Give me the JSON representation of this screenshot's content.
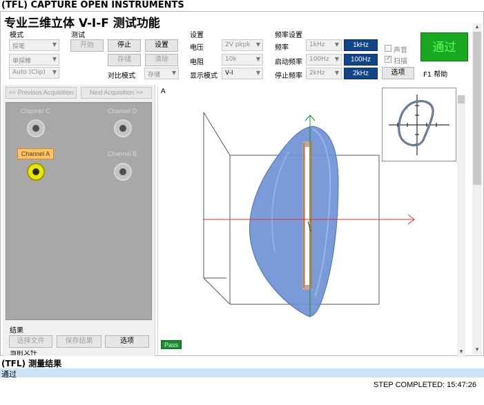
{
  "window": {
    "title": "(TFL) CAPTURE OPEN INSTRUMENTS",
    "app_title": "专业三维立体 V-I-F 测试功能"
  },
  "mode_group": {
    "label": "模式",
    "mode_select": "探笔",
    "probe_select": "单探棒",
    "range_select": "Auto (Clip)"
  },
  "test_group": {
    "label": "测试",
    "start": "开始",
    "stop": "停止",
    "settings": "设置",
    "store": "存储",
    "clear": "清除",
    "compare_mode_label": "对比模式",
    "compare_mode_value": "存储"
  },
  "settings_group": {
    "label": "设置",
    "voltage_label": "电压",
    "voltage_value": "2V pkpk",
    "resistance_label": "电阻",
    "resistance_value": "10k",
    "display_mode_label": "显示模式",
    "display_mode_value": "V-I"
  },
  "freq_group": {
    "label": "频率设置",
    "freq_label": "频率",
    "freq_select": "1kHz",
    "freq_value": "1kHz",
    "start_freq_label": "启动频率",
    "start_freq_select": "100Hz",
    "start_freq_value": "100Hz",
    "stop_freq_label": "停止频率",
    "stop_freq_select": "2kHz",
    "stop_freq_value": "2kHz",
    "sound_label": "声音",
    "sweep_label": "扫描",
    "options": "选项"
  },
  "status": {
    "pass_big": "通过",
    "help": "F1 帮助",
    "pass_small": "Pass"
  },
  "acquisition": {
    "prev": "<< Previous Acquisition",
    "next": "Next Acquisition >>"
  },
  "channels": [
    {
      "name": "Channel C",
      "active": false
    },
    {
      "name": "Channel D",
      "active": false
    },
    {
      "name": "Channel A",
      "active": true
    },
    {
      "name": "Channel B",
      "active": false
    }
  ],
  "results_group": {
    "label": "结果",
    "select_file": "选择文件",
    "save_results": "保存结果",
    "options": "选项",
    "current_file": "当前文件"
  },
  "plot": {
    "channel_letter": "A"
  },
  "measurement": {
    "title": "(TFL) 测量结果",
    "result": "通过",
    "step": "STEP COMPLETED: 15:47:26"
  },
  "colors": {
    "pass_green": "#1aa823",
    "freq_blue": "#114488",
    "active_channel": "#ffc46a",
    "trace_blue": "#5b7fc8",
    "axis_red": "#e03030",
    "axis_green": "#1a8a30"
  }
}
